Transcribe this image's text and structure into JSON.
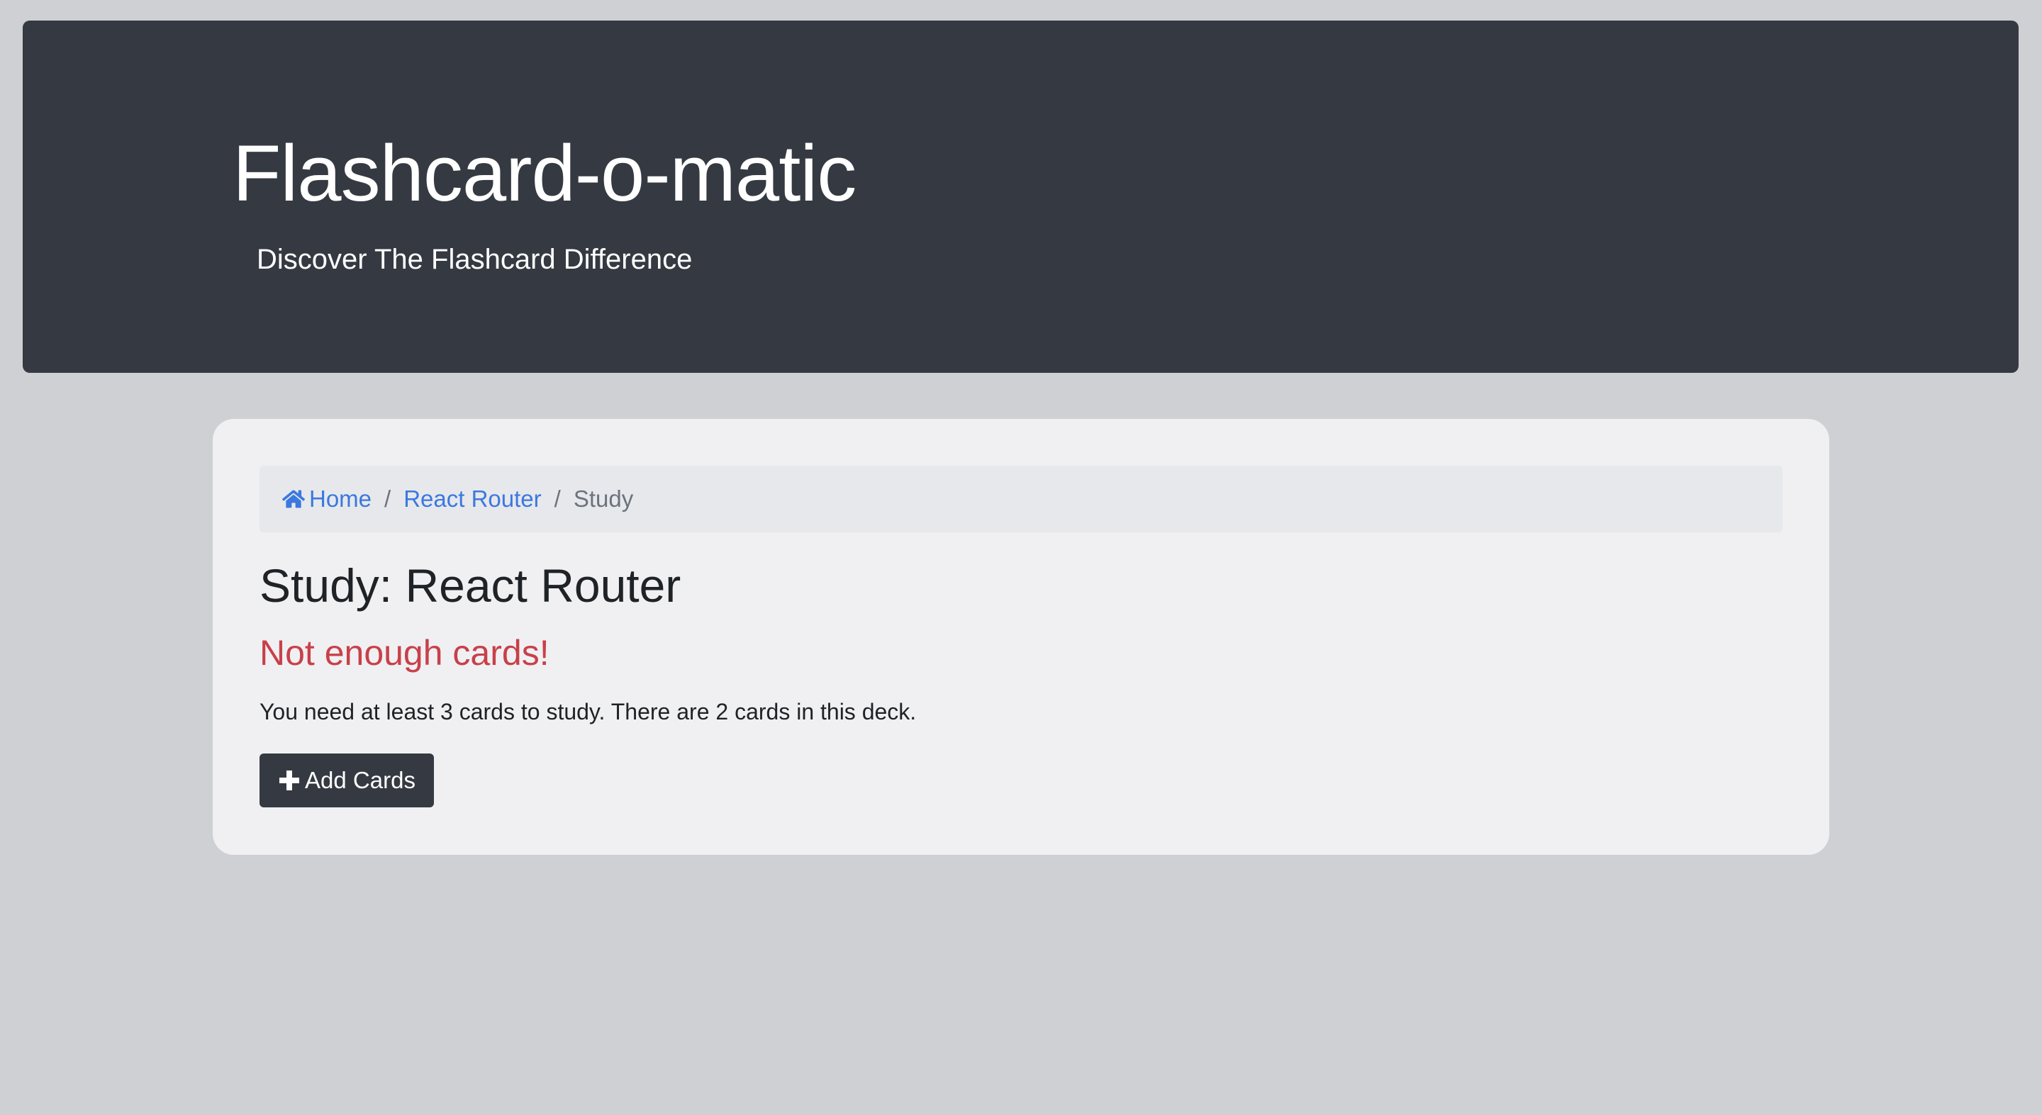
{
  "header": {
    "title": "Flashcard-o-matic",
    "subtitle": "Discover The Flashcard Difference"
  },
  "breadcrumb": {
    "home_label": "Home",
    "home_icon": "home-icon",
    "deck_label": "React Router",
    "current_label": "Study",
    "separator": "/"
  },
  "main": {
    "title": "Study: React Router",
    "warning_title": "Not enough cards!",
    "warning_text": "You need at least 3 cards to study. There are 2 cards in this deck.",
    "add_button_label": "Add Cards",
    "add_button_icon": "plus-icon"
  },
  "colors": {
    "background": "#cfd0d4",
    "header": "#353a42",
    "card": "#f0f0f2",
    "breadcrumb_bg": "#e7e8eb",
    "link": "#3b78e0",
    "warning": "#c8404a",
    "button": "#353a42"
  }
}
